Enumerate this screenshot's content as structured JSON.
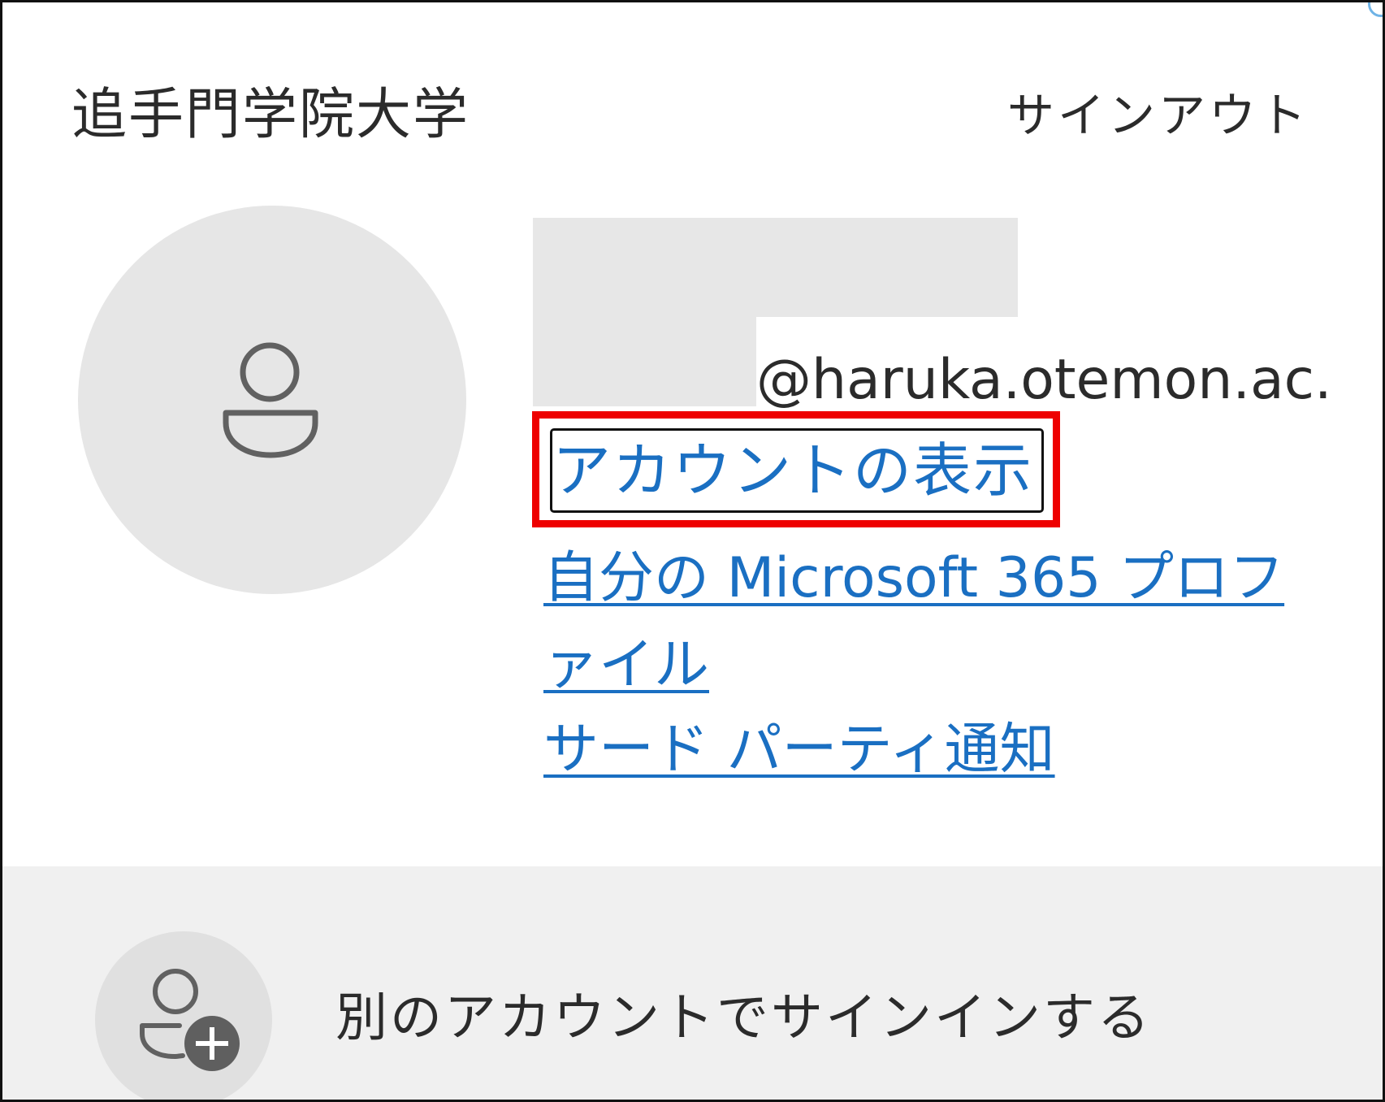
{
  "header": {
    "org_name": "追手門学院大学",
    "signout_label": "サインアウト"
  },
  "account": {
    "email_domain": "@haruka.otemon.ac.jp",
    "view_account_label": "アカウントの表示",
    "profile_link_label": "自分の Microsoft 365 プロファイル",
    "third_party_label": "サード パーティ通知"
  },
  "other_account": {
    "label": "別のアカウントでサインインする"
  },
  "colors": {
    "link": "#1a6fc2",
    "highlight": "#ee0000",
    "avatar_bg": "#e6e6e6",
    "footer_bg": "#f0f0f0"
  },
  "icons": {
    "avatar": "person-icon",
    "add_account": "person-add-icon"
  }
}
